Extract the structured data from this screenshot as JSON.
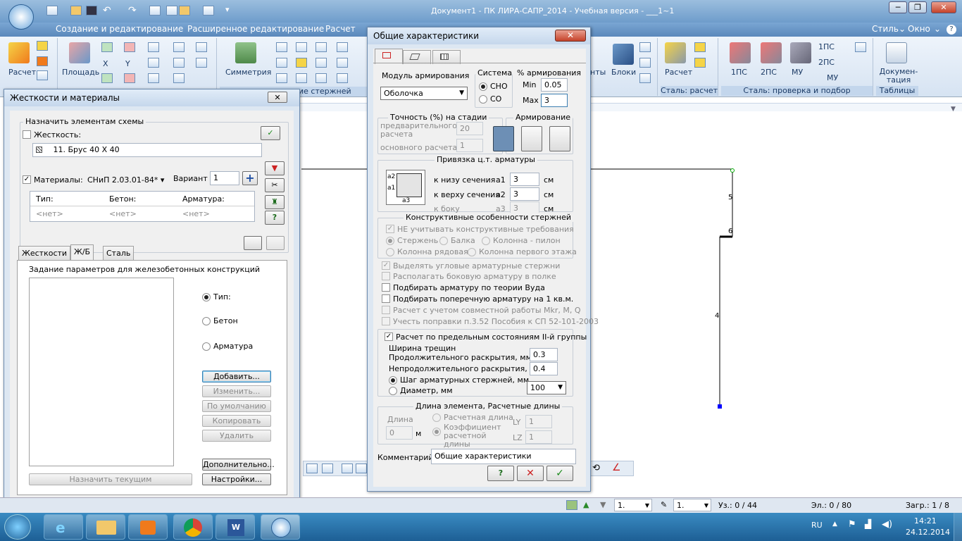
{
  "app": {
    "title": "Документ1 - ПК ЛИРА-САПР_2014 - Учебная версия - ___1~1",
    "menus": [
      "Создание и редактирование",
      "Расширенное редактирование",
      "Расчет"
    ],
    "menus_right": [
      "Стиль",
      "Окно"
    ],
    "win_controls": [
      "─",
      "❐",
      "✕"
    ]
  },
  "ribbon": {
    "left": {
      "calc_label": "Расчет",
      "area_label": "Площадь",
      "x_label": "X",
      "y_label": "Y",
      "symmetry_label": "Симметрия",
      "rods_footer": "ие стержней"
    },
    "right": {
      "nts_label": "нты",
      "blocks_label": "Блоки",
      "calc_label": "Расчет",
      "steel_calc_footer": "Сталь: расчет",
      "ps1": "1ПС",
      "ps2": "2ПС",
      "mu": "МУ",
      "ps1_small": "1ПС",
      "ps2_small": "2ПС",
      "mu_small": "МУ",
      "steel_check_footer": "Сталь: проверка и подбор",
      "docs_label": "Докумен-тация",
      "tables_footer": "Таблицы"
    }
  },
  "canvas": {
    "node_labels": [
      "5",
      "6",
      "4"
    ]
  },
  "stiffness_dialog": {
    "title": "Жесткости и материалы",
    "close": "✕",
    "assign_group": "Назначить элементам схемы",
    "stiffness_label": "Жесткость:",
    "stiffness_value": "11. Брус 40 Х 40",
    "materials_label": "Материалы:",
    "norm": "СНиП 2.03.01-84* ▾",
    "variant_label": "Вариант",
    "variant_value": "1",
    "columns": [
      "Тип:",
      "Бетон:",
      "Арматура:"
    ],
    "row": [
      "<нет>",
      "<нет>",
      "<нет>"
    ],
    "tabs": [
      "Жесткости",
      "Ж/Б",
      "Сталь"
    ],
    "rc_group": "Задание параметров для железобетонных конструкций",
    "radio_type": "Тип:",
    "radio_concrete": "Бетон",
    "radio_rebar": "Арматура",
    "btn_add": "Добавить...",
    "btn_edit": "Изменить...",
    "btn_default": "По умолчанию",
    "btn_copy": "Копировать",
    "btn_delete": "Удалить",
    "btn_assign_current": "Назначить текущим",
    "btn_more": "Дополнительно...",
    "btn_settings": "Настройки...",
    "plus_icon_text": "+",
    "help_icon_text": "?"
  },
  "general_dialog": {
    "title": "Общие характеристики",
    "close": "✕",
    "module_label": "Модуль армирования",
    "module_value": "Оболочка",
    "system_label": "Система",
    "system_opt1": "СНО",
    "system_opt2": "СО",
    "pct_label": "% армирования",
    "min_label": "Min",
    "min_value": "0.05",
    "max_label": "Max",
    "max_value": "3",
    "accuracy_group": "Точность (%) на стадии",
    "prelim_label": "предварительного расчета",
    "prelim_value": "20",
    "main_label": "основного расчета",
    "main_value": "1",
    "reinf_group": "Армирование",
    "anchor_group": "Привязка ц.т. арматуры",
    "bottom_label": "к низу сечения",
    "a1_label": "a1",
    "a1_value": "3",
    "top_label": "к верху сечения",
    "a2_label": "a2",
    "a2_value": "3",
    "side_label": "к боку",
    "a3_label": "a3",
    "a3_value": "3",
    "unit_cm": "см",
    "diagram_a1": "a1",
    "diagram_a2": "a2",
    "diagram_a3": "a3",
    "constructive_group": "Конструктивные особенности стержней",
    "ignore_constructive": "НЕ учитывать конструктивные требования",
    "rod_rod": "Стержень",
    "rod_beam": "Балка",
    "rod_column_pylon": "Колонна - пилон",
    "rod_column_row": "Колонна рядовая",
    "rod_column_first": "Колонна первого этажа",
    "chk_corner": "Выделять угловые арматурные стержни",
    "chk_side": "Располагать боковую арматуру в полке",
    "chk_wood": "Подбирать арматуру по теории Вуда",
    "chk_transverse": "Подбирать поперечную арматуру на 1 кв.м.",
    "chk_joint": "Расчет с учетом совместной работы Mkr, M, Q",
    "chk_correction": "Учесть поправки п.3.52 Пособия к СП 52-101-2003",
    "chk_limit_states": "Расчет по предельным состояниям II-й группы",
    "crack_width": "Ширина трещин",
    "crack_long_label": "Продолжительного раскрытия, мм",
    "crack_long_value": "0.3",
    "crack_short_label": "Непродолжительного раскрытия, мм",
    "crack_short_value": "0.4",
    "step_label": "Шаг арматурных стержней, мм",
    "diameter_label": "Диаметр, мм",
    "step_value": "100",
    "length_group": "Длина элемента,  Расчетные длины",
    "length_label": "Длина",
    "length_value": "0",
    "unit_m": "м",
    "calc_length": "Расчетная длина",
    "coef_length": "Коэффициент расчетной длины",
    "ly_label": "LY",
    "ly_value": "1",
    "lz_label": "LZ",
    "lz_value": "1",
    "comment_label": "Комментарий",
    "comment_value": "Общие характеристики",
    "help_text": "?",
    "cancel_text": "✕",
    "ok_text": "✓"
  },
  "statusbar": {
    "combo1": "1.",
    "combo2": "1.",
    "nodes": "Уз.: 0 / 44",
    "elements": "Эл.: 0 / 80",
    "loads": "Загр.: 1 / 8"
  },
  "taskbar": {
    "lang": "RU",
    "time": "14:21",
    "date": "24.12.2014"
  }
}
